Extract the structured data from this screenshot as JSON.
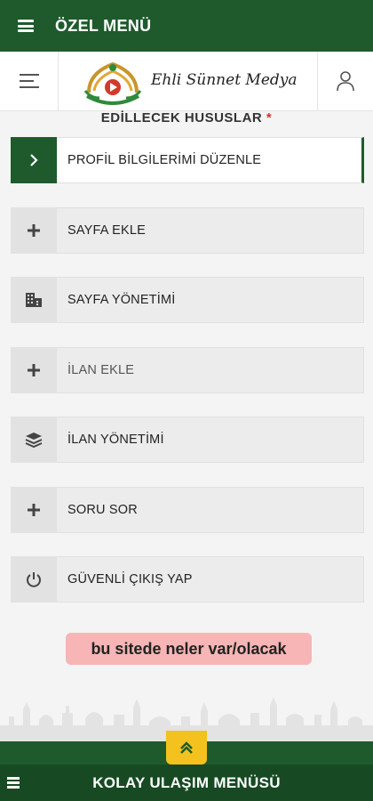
{
  "topbar": {
    "title": "ÖZEL MENÜ",
    "color": "#1f5a2c"
  },
  "header": {
    "brand": "Ehli Sünnet Medya"
  },
  "cut_heading": {
    "text": "EDİLLECEK HUSUSLAR",
    "star": "*"
  },
  "menu": {
    "items": [
      {
        "label": "PROFİL BİLGİLERİMİ DÜZENLE",
        "icon": "chevron-right-icon"
      },
      {
        "label": "SAYFA EKLE",
        "icon": "plus-icon"
      },
      {
        "label": "SAYFA YÖNETİMİ",
        "icon": "building-icon"
      },
      {
        "label": "İLAN EKLE",
        "icon": "plus-icon"
      },
      {
        "label": "İLAN YÖNETİMİ",
        "icon": "layers-icon"
      },
      {
        "label": "SORU SOR",
        "icon": "plus-icon"
      },
      {
        "label": "GÜVENLİ ÇIKIŞ YAP",
        "icon": "power-icon"
      }
    ]
  },
  "notice": {
    "text": "bu sitede neler var/olacak",
    "bg": "#f7b5b5"
  },
  "footer": {
    "label": "KOLAY ULAŞIM MENÜSÜ",
    "accent": "#f3c21f"
  }
}
